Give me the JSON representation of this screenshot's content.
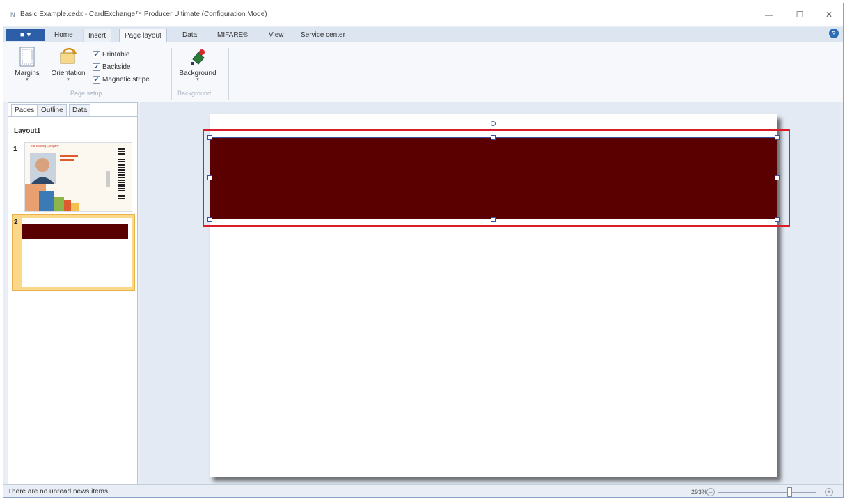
{
  "window": {
    "app_icon": "N·",
    "title": "Basic Example.cedx - CardExchange™ Producer Ultimate (Configuration Mode)",
    "minimize_glyph": "—",
    "maximize_glyph": "☐",
    "close_glyph": "✕"
  },
  "ribbon": {
    "file_label": "■ ▾",
    "tabs": [
      {
        "label": "Home"
      },
      {
        "label": "Insert"
      },
      {
        "label": "Page layout"
      },
      {
        "label": "Data"
      },
      {
        "label": "MIFARE®"
      },
      {
        "label": "View"
      },
      {
        "label": "Service center"
      }
    ],
    "active_tab": "Page layout",
    "help_glyph": "?",
    "page_setup": {
      "margins_label": "Margins",
      "orientation_label": "Orientation",
      "printable_label": "Printable",
      "backside_label": "Backside",
      "magnetic_stripe_label": "Magnetic stripe",
      "printable_checked": true,
      "backside_checked": true,
      "magnetic_stripe_checked": true,
      "group_label": "Page setup"
    },
    "background": {
      "background_label": "Background",
      "group_label": "Background"
    }
  },
  "left_pane": {
    "tabs": [
      {
        "label": "Pages"
      },
      {
        "label": "Outline"
      },
      {
        "label": "Data"
      }
    ],
    "active_tab": "Pages",
    "layout_name": "Layout1",
    "pages": [
      {
        "number": "1",
        "company_text": "The Building Company",
        "selected": false
      },
      {
        "number": "2",
        "selected": true
      }
    ]
  },
  "canvas": {
    "band_color": "#5a0000",
    "selection_color": "#d91e2a"
  },
  "status": {
    "message": "There are no unread news items.",
    "zoom": "293%"
  }
}
